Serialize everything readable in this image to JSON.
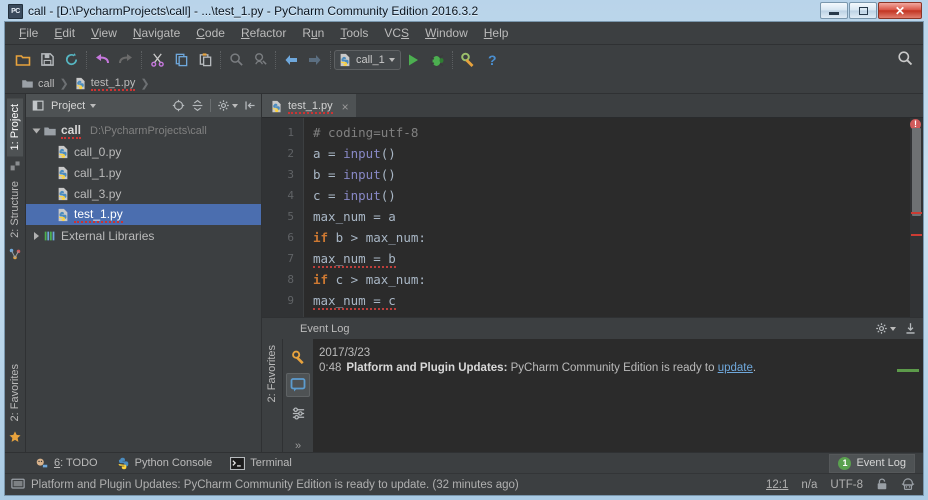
{
  "window": {
    "title": "call - [D:\\PycharmProjects\\call] - ...\\test_1.py - PyCharm Community Edition 2016.3.2",
    "app_icon": "pycharm-icon",
    "minimize_label": "Minimize",
    "maximize_label": "Maximize",
    "close_label": "Close"
  },
  "menubar": {
    "items": [
      {
        "label": "File",
        "mnemonic": "F"
      },
      {
        "label": "Edit",
        "mnemonic": "E"
      },
      {
        "label": "View",
        "mnemonic": "V"
      },
      {
        "label": "Navigate",
        "mnemonic": "N"
      },
      {
        "label": "Code",
        "mnemonic": "C"
      },
      {
        "label": "Refactor",
        "mnemonic": "R"
      },
      {
        "label": "Run",
        "mnemonic": "u"
      },
      {
        "label": "Tools",
        "mnemonic": "T"
      },
      {
        "label": "VCS",
        "mnemonic": "S"
      },
      {
        "label": "Window",
        "mnemonic": "W"
      },
      {
        "label": "Help",
        "mnemonic": "H"
      }
    ]
  },
  "toolbar": {
    "buttons": [
      "open-folder-icon",
      "save-all-icon",
      "sync-refresh-icon",
      "undo-icon",
      "redo-icon",
      "cut-icon",
      "copy-icon",
      "paste-icon",
      "find-icon",
      "replace-icon",
      "back-icon",
      "forward-icon"
    ],
    "run_config": {
      "label": "call_1",
      "icon": "python-file-icon"
    },
    "run_label": "Run",
    "debug_label": "Debug",
    "settings_label": "Settings",
    "help_label": "Help",
    "search_label": "Search Everywhere"
  },
  "breadcrumb": {
    "items": [
      {
        "label": "call",
        "icon": "folder-icon"
      },
      {
        "label": "test_1.py",
        "icon": "python-file-icon"
      }
    ]
  },
  "left_strip": {
    "tabs": [
      {
        "label": "1: Project",
        "active": true
      },
      {
        "label": "2: Structure",
        "active": false
      },
      {
        "label": "2: Favorites",
        "active": false
      }
    ]
  },
  "project_panel": {
    "title": "Project",
    "tools": [
      "locate-target-icon",
      "collapse-all-icon",
      "gear-icon",
      "hide-panel-icon"
    ],
    "tree": [
      {
        "label": "call",
        "path": "D:\\PycharmProjects\\call",
        "type": "folder",
        "expanded": true,
        "depth": 0,
        "selected": false
      },
      {
        "label": "call_0.py",
        "path": "",
        "type": "python",
        "depth": 1,
        "selected": false
      },
      {
        "label": "call_1.py",
        "path": "",
        "type": "python",
        "depth": 1,
        "selected": false
      },
      {
        "label": "call_3.py",
        "path": "",
        "type": "python",
        "depth": 1,
        "selected": false
      },
      {
        "label": "test_1.py",
        "path": "",
        "type": "python",
        "depth": 1,
        "selected": true
      },
      {
        "label": "External Libraries",
        "path": "",
        "type": "library",
        "expanded": false,
        "depth": 0,
        "selected": false
      }
    ]
  },
  "editor": {
    "tabs": [
      {
        "label": "test_1.py",
        "icon": "python-file-icon",
        "active": true,
        "close_label": "×"
      }
    ],
    "line_numbers": [
      "1",
      "2",
      "3",
      "4",
      "5",
      "6",
      "7",
      "8",
      "9"
    ],
    "lines": [
      {
        "n": "1",
        "tokens": [
          {
            "t": "# coding=utf-8",
            "c": "cm"
          }
        ]
      },
      {
        "n": "2",
        "tokens": [
          {
            "t": "a = ",
            "c": "id"
          },
          {
            "t": "input",
            "c": "fn"
          },
          {
            "t": "()",
            "c": "id"
          }
        ]
      },
      {
        "n": "3",
        "tokens": [
          {
            "t": "b = ",
            "c": "id"
          },
          {
            "t": "input",
            "c": "fn"
          },
          {
            "t": "()",
            "c": "id"
          }
        ]
      },
      {
        "n": "4",
        "tokens": [
          {
            "t": "c = ",
            "c": "id"
          },
          {
            "t": "input",
            "c": "fn"
          },
          {
            "t": "()",
            "c": "id"
          }
        ]
      },
      {
        "n": "5",
        "tokens": [
          {
            "t": "max_num = a",
            "c": "id"
          }
        ]
      },
      {
        "n": "6",
        "tokens": [
          {
            "t": "if",
            "c": "kw"
          },
          {
            "t": " b > max_num:",
            "c": "id"
          }
        ]
      },
      {
        "n": "7",
        "tokens": [
          {
            "t": "max_num = b",
            "c": "id err-u"
          }
        ]
      },
      {
        "n": "8",
        "tokens": [
          {
            "t": "if",
            "c": "kw"
          },
          {
            "t": " c > max_num:",
            "c": "id"
          }
        ]
      },
      {
        "n": "9",
        "tokens": [
          {
            "t": "max_num = c",
            "c": "id err-u"
          }
        ]
      }
    ],
    "error_count": "!"
  },
  "event_log": {
    "title": "Event Log",
    "tools": [
      "gear-icon",
      "hide-panel-icon"
    ],
    "side_tab": "2: Favorites",
    "icons": [
      "settings-wrench-icon",
      "balloon-icon",
      "configure-icon"
    ],
    "expand_label": "»",
    "entry": {
      "date": "2017/3/23",
      "time": "0:48",
      "source": "Platform and Plugin Updates:",
      "message": "PyCharm Community Edition is ready to",
      "link": "update",
      "suffix": "."
    }
  },
  "bottom_tabs": {
    "items": [
      {
        "label": "6: TODO",
        "mnemonic": "6",
        "icon": "todo-icon"
      },
      {
        "label": "Python Console",
        "icon": "python-console-icon"
      },
      {
        "label": "Terminal",
        "icon": "terminal-icon"
      }
    ],
    "event_log_tab": {
      "label": "Event Log",
      "count": "1"
    }
  },
  "statusbar": {
    "icon": "screen-icon",
    "message": "Platform and Plugin Updates: PyCharm Community Edition is ready to update. (32 minutes ago)",
    "position": "12:1",
    "line_separator": "n/a",
    "encoding": "UTF-8",
    "lock_icon": "lock-icon",
    "hector_icon": "hector-inspection-icon"
  },
  "colors": {
    "accent_blue": "#4b6eaf",
    "editor_bg": "#2b2b2b",
    "panel_bg": "#3c3f41",
    "keyword": "#cc7832",
    "function": "#8888c6",
    "comment": "#808080",
    "text": "#a9b7c6",
    "error_red": "#bc3f3c",
    "green_badge": "#5aa14f"
  }
}
